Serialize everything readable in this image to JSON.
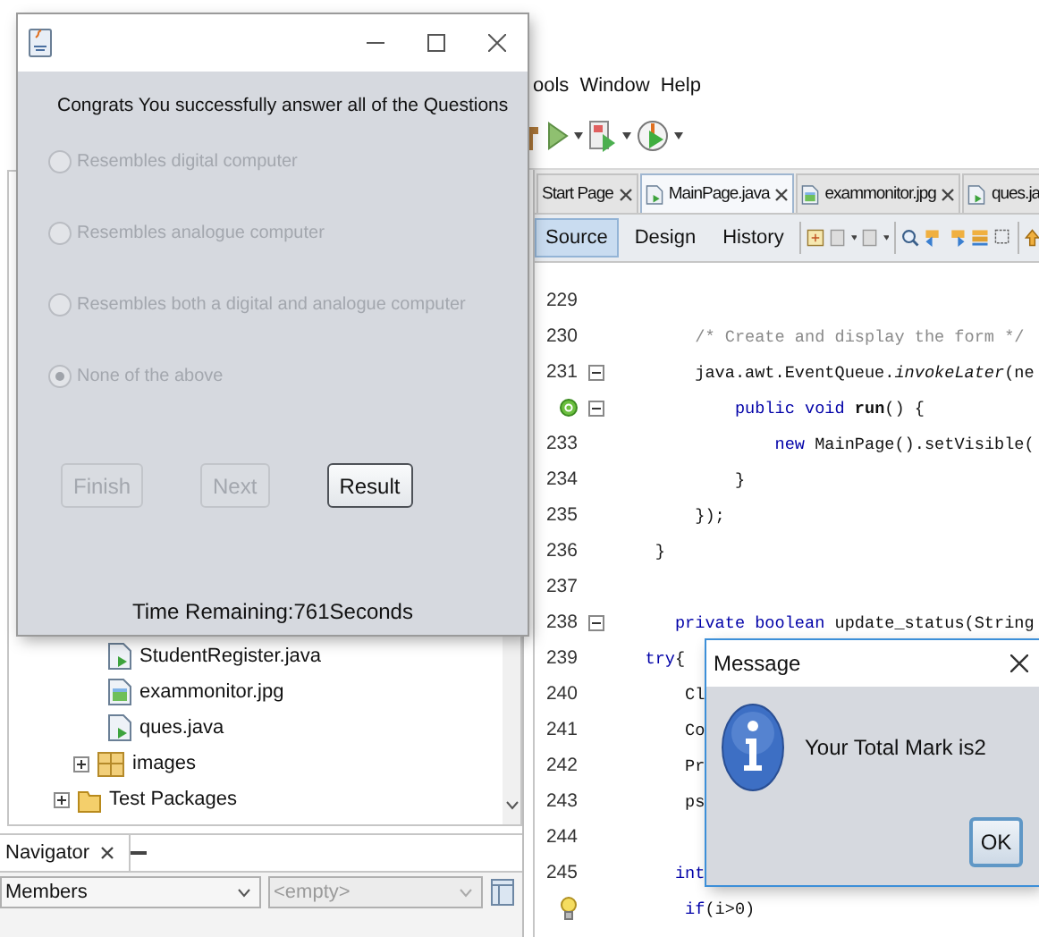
{
  "ide": {
    "menu": [
      "ools",
      "Window",
      "Help"
    ],
    "editor_tabs": [
      {
        "label": "Start Page",
        "selected": false
      },
      {
        "label": "MainPage.java",
        "selected": true
      },
      {
        "label": "exammonitor.jpg",
        "selected": false
      },
      {
        "label": "ques.ja",
        "selected": false
      }
    ],
    "editor_views": [
      {
        "label": "Source",
        "selected": true
      },
      {
        "label": "Design",
        "selected": false
      },
      {
        "label": "History",
        "selected": false
      }
    ],
    "code_lines": [
      {
        "number": "229"
      },
      {
        "number": "230",
        "segments": [
          {
            "text": "        /* Create and display the form */",
            "kind": "comment"
          }
        ]
      },
      {
        "number": "231",
        "fold": true,
        "segments": [
          {
            "text": "        java.awt.EventQueue.",
            "kind": "plain"
          },
          {
            "text": "invokeLater",
            "kind": "italic"
          },
          {
            "text": "(ne",
            "kind": "plain"
          }
        ]
      },
      {
        "kind": "override",
        "fold": true,
        "segments": [
          {
            "text": "            public void",
            "kind": "keyword"
          },
          {
            "text": " run",
            "kind": "bold"
          },
          {
            "text": "() {",
            "kind": "plain"
          }
        ]
      },
      {
        "number": "233",
        "segments": [
          {
            "text": "                new",
            "kind": "keyword"
          },
          {
            "text": " MainPage().setVisible(",
            "kind": "plain"
          }
        ]
      },
      {
        "number": "234",
        "segments": [
          {
            "text": "            }",
            "kind": "plain"
          }
        ]
      },
      {
        "number": "235",
        "segments": [
          {
            "text": "        });",
            "kind": "plain"
          }
        ]
      },
      {
        "number": "236",
        "segments": [
          {
            "text": "    }",
            "kind": "plain"
          }
        ]
      },
      {
        "number": "237"
      },
      {
        "number": "238",
        "fold": true,
        "segments": [
          {
            "text": "      private boolean",
            "kind": "keyword"
          },
          {
            "text": " update_status(String",
            "kind": "plain"
          }
        ]
      },
      {
        "number": "239",
        "segments": [
          {
            "text": "   try",
            "kind": "keyword"
          },
          {
            "text": "{",
            "kind": "plain"
          }
        ]
      },
      {
        "number": "240",
        "segments": [
          {
            "text": "       Cl",
            "kind": "plain"
          }
        ]
      },
      {
        "number": "241",
        "segments": [
          {
            "text": "       Co",
            "kind": "plain"
          }
        ]
      },
      {
        "number": "242",
        "segments": [
          {
            "text": "       Pr",
            "kind": "plain"
          }
        ]
      },
      {
        "number": "243",
        "segments": [
          {
            "text": "       ps",
            "kind": "plain"
          }
        ]
      },
      {
        "number": "244"
      },
      {
        "number": "245",
        "segments": [
          {
            "text": "      int",
            "kind": "keyword"
          }
        ]
      },
      {
        "kind": "hint",
        "segments": [
          {
            "text": "       if",
            "kind": "keyword"
          },
          {
            "text": "(i>0)",
            "kind": "plain"
          }
        ]
      }
    ],
    "project_tree": [
      {
        "label": "StudentRegister.java",
        "kind": "java-file"
      },
      {
        "label": "exammonitor.jpg",
        "kind": "image-file"
      },
      {
        "label": "ques.java",
        "kind": "java-file"
      },
      {
        "label": "images",
        "kind": "package",
        "expanded": false
      },
      {
        "label": "Test Packages",
        "kind": "folder",
        "expanded": false
      }
    ],
    "navigator": {
      "title": "Navigator",
      "filter": "Members",
      "second_combo": {
        "value": "<empty>",
        "disabled": true
      }
    }
  },
  "quiz": {
    "heading": "Congrats You successfully answer all of the Questions",
    "options": [
      {
        "label": "Resembles digital computer",
        "selected": false,
        "disabled": true
      },
      {
        "label": "Resembles analogue computer",
        "selected": false,
        "disabled": true
      },
      {
        "label": "Resembles both a digital and analogue computer",
        "selected": false,
        "disabled": true
      },
      {
        "label": "None of the above",
        "selected": true,
        "disabled": true
      }
    ],
    "buttons": [
      {
        "label": "Finish",
        "disabled": true
      },
      {
        "label": "Next",
        "disabled": true
      },
      {
        "label": "Result",
        "disabled": false
      }
    ],
    "timer": "Time Remaining:761Seconds"
  },
  "dialog": {
    "title": "Message",
    "message": "Your Total Mark is2",
    "button": "OK"
  }
}
